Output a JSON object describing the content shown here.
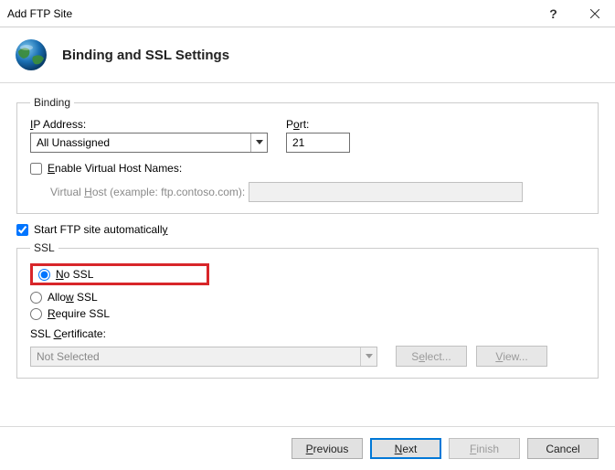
{
  "window": {
    "title": "Add FTP Site",
    "heading": "Binding and SSL Settings"
  },
  "binding": {
    "legend": "Binding",
    "ipLabel": "IP Address:",
    "ipValue": "All Unassigned",
    "portLabel": "Port:",
    "portValue": "21",
    "enableVhostLabel": "Enable Virtual Host Names:",
    "vhostLabel": "Virtual Host (example: ftp.contoso.com):",
    "vhostValue": ""
  },
  "autostartLabel": "Start FTP site automatically",
  "ssl": {
    "legend": "SSL",
    "noSsl": "No SSL",
    "allowSsl": "Allow SSL",
    "requireSsl": "Require SSL",
    "certLabel": "SSL Certificate:",
    "certValue": "Not Selected",
    "selectBtn": "Select...",
    "viewBtn": "View..."
  },
  "buttons": {
    "previous": "Previous",
    "next": "Next",
    "finish": "Finish",
    "cancel": "Cancel"
  }
}
